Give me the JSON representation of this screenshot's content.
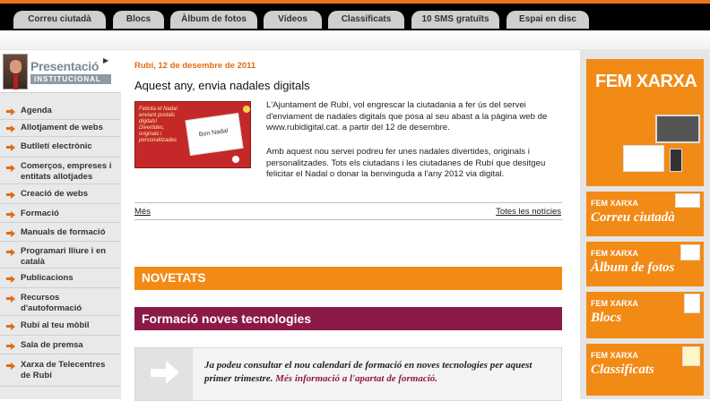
{
  "tabs": [
    "Correu ciutadà",
    "Blocs",
    "Àlbum de fotos",
    "Vídeos",
    "Classificats",
    "10 SMS gratuïts",
    "Espai en disc"
  ],
  "sidebar": {
    "header_title": "Presentació",
    "header_subtitle": "INSTITUCIONAL",
    "items": [
      {
        "label": "Agenda"
      },
      {
        "label": "Allotjament de webs"
      },
      {
        "label": "Butlletí electrònic"
      },
      {
        "label": "Comerços, empreses i entitats allotjades"
      },
      {
        "label": "Creació de webs"
      },
      {
        "label": "Formació"
      },
      {
        "label": "Manuals de formació"
      },
      {
        "label": "Programari lliure i en català"
      },
      {
        "label": "Publicacions"
      },
      {
        "label": "Recursos d'autoformació"
      },
      {
        "label": "Rubí al teu mòbil"
      },
      {
        "label": "Sala de premsa"
      },
      {
        "label": "Xarxa de Telecentres de Rubí"
      }
    ]
  },
  "article": {
    "date": "Rubí, 12 de desembre de 2011",
    "headline": "Aquest any, envia nadales digitals",
    "image_text": "Felicita el Nadal enviant postals digitals! Divertides, originals i personalitzades",
    "image_card": "Bon Nadal",
    "paragraph1": "L'Ajuntament de Rubí, vol engrescar la ciutadania a fer ús del servei d'enviament de nadales digitals que posa al seu abast a la pàgina web de www.rubidigital.cat. a partir del 12 de desembre.",
    "paragraph2": "Amb aquest nou servei podreu fer unes nadales divertides, originals i personalitzades. Tots els ciutadans i les ciutadanes de Rubí que desitgeu felicitar el Nadal o donar la benvinguda a l'any 2012 via digital.",
    "more_link": "Més",
    "all_news_link": "Totes les notícies"
  },
  "sections": {
    "novetats": "NOVETATS",
    "formacio_title": "Formació noves tecnologies",
    "formacio_text": "Ja podeu consultar el nou calendari de formació en noves tecnologies per aquest primer trimestre.",
    "formacio_more": "Més informació a l'apartat de formació."
  },
  "right": {
    "big_title": "FEM XARXA",
    "promos": [
      {
        "small": "FEM XARXA",
        "big": "Correu ciutadà"
      },
      {
        "small": "FEM XARXA",
        "big": "Àlbum de fotos"
      },
      {
        "small": "FEM XARXA",
        "big": "Blocs"
      },
      {
        "small": "FEM XARXA",
        "big": "Classificats"
      }
    ]
  },
  "colors": {
    "accent_orange": "#f28a16",
    "maroon": "#8c1a48",
    "date_orange": "#e36b10"
  }
}
